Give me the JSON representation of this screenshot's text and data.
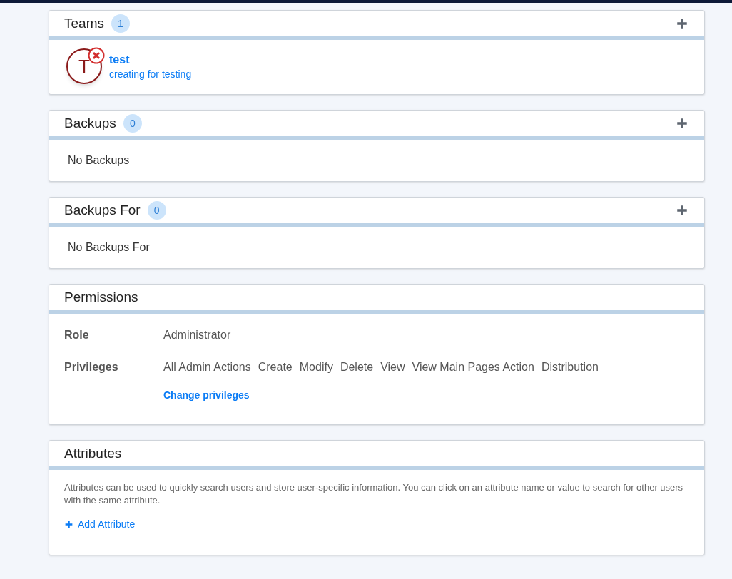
{
  "sections": [
    {
      "kind": "teams",
      "title": "Teams",
      "count": "1",
      "add": true,
      "items": [
        {
          "initial": "T",
          "name": "test",
          "description": "creating for testing",
          "error": true
        }
      ]
    },
    {
      "kind": "empty",
      "title": "Backups",
      "count": "0",
      "add": true,
      "empty_text": "No Backups"
    },
    {
      "kind": "empty",
      "title": "Backups For",
      "count": "0",
      "add": true,
      "empty_text": "No Backups For"
    },
    {
      "kind": "permissions",
      "title": "Permissions",
      "add": false,
      "role_label": "Role",
      "role": "Administrator",
      "privileges_label": "Privileges",
      "privileges": [
        "All Admin Actions",
        "Create",
        "Modify",
        "Delete",
        "View",
        "View Main Pages Action",
        "Distribution"
      ],
      "change_link": "Change privileges"
    },
    {
      "kind": "attributes",
      "title": "Attributes",
      "add": false,
      "description": "Attributes can be used to quickly search users and store user-specific information. You can click on an attribute name or value to search for other users with the same attribute.",
      "add_link": "Add Attribute"
    }
  ]
}
